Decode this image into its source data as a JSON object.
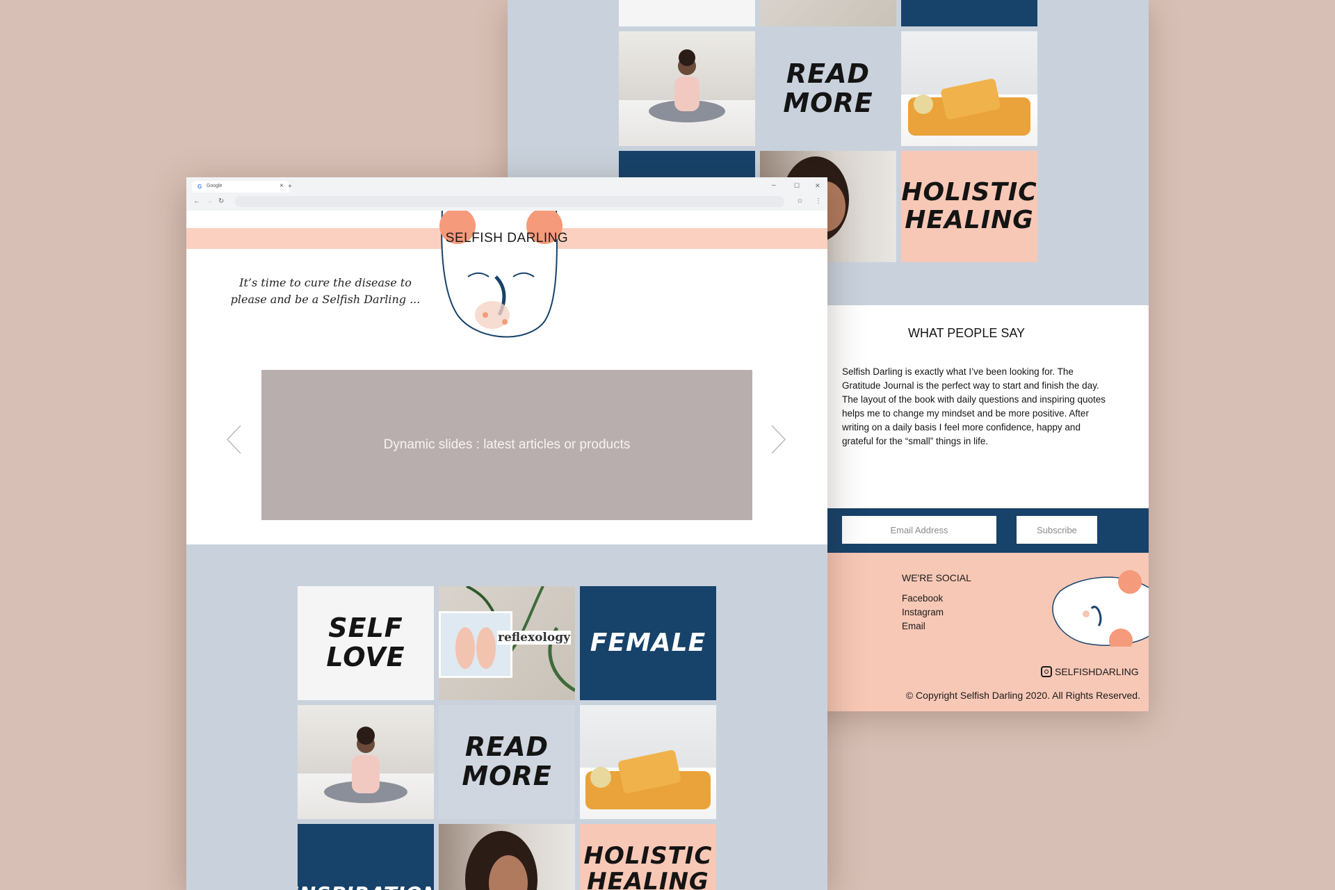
{
  "browser": {
    "tab_title": "Google",
    "tab_close": "×",
    "new_tab": "+",
    "minimize": "–",
    "maximize": "☐",
    "close": "✕",
    "back": "←",
    "forward": "→",
    "reload": "↻",
    "bookmark": "☆",
    "menu": "⋮"
  },
  "header": {
    "site_title": "SELFISH DARLING",
    "tagline_line1": "It’s time to cure the disease to",
    "tagline_line2": "please and be a Selfish Darling ..."
  },
  "slider": {
    "text": "Dynamic slides : latest articles or products",
    "prev_icon": "chevron-left-icon",
    "next_icon": "chevron-right-icon"
  },
  "tiles": {
    "self_love_1": "SELF",
    "self_love_2": "LOVE",
    "reflexology": "reflexology",
    "female": "FEMALE",
    "read_more_1": "READ",
    "read_more_2": "MORE",
    "inspiration": "INSPIRATION",
    "holistic_1": "HOLISTIC",
    "holistic_2": "HEALING"
  },
  "testimonials": {
    "heading": "WHAT PEOPLE SAY",
    "body": "Selfish Darling is exactly what I’ve been looking for. The Gratitude Journal is the perfect way to start and finish the day. The layout of the book with daily questions and inspiring quotes helps me to change my mindset and be more positive. After writing on a daily basis I feel more confidence, happy and grateful for the “small” things in life."
  },
  "subscribe": {
    "email_placeholder": "Email Address",
    "button_label": "Subscribe"
  },
  "footer": {
    "social_heading": "WE'RE SOCIAL",
    "links": [
      "Facebook",
      "Instagram",
      "Email"
    ],
    "instagram_handle": "SELFISHDARLING",
    "copyright": "© Copyright Selfish Darling 2020. All Rights Reserved."
  },
  "colors": {
    "background": "#d8bfb5",
    "navy": "#17426a",
    "pink": "#f8c8b6",
    "grey_blue": "#c9d2dc",
    "slider": "#b9aeae",
    "accent_orange": "#f59a7a"
  }
}
